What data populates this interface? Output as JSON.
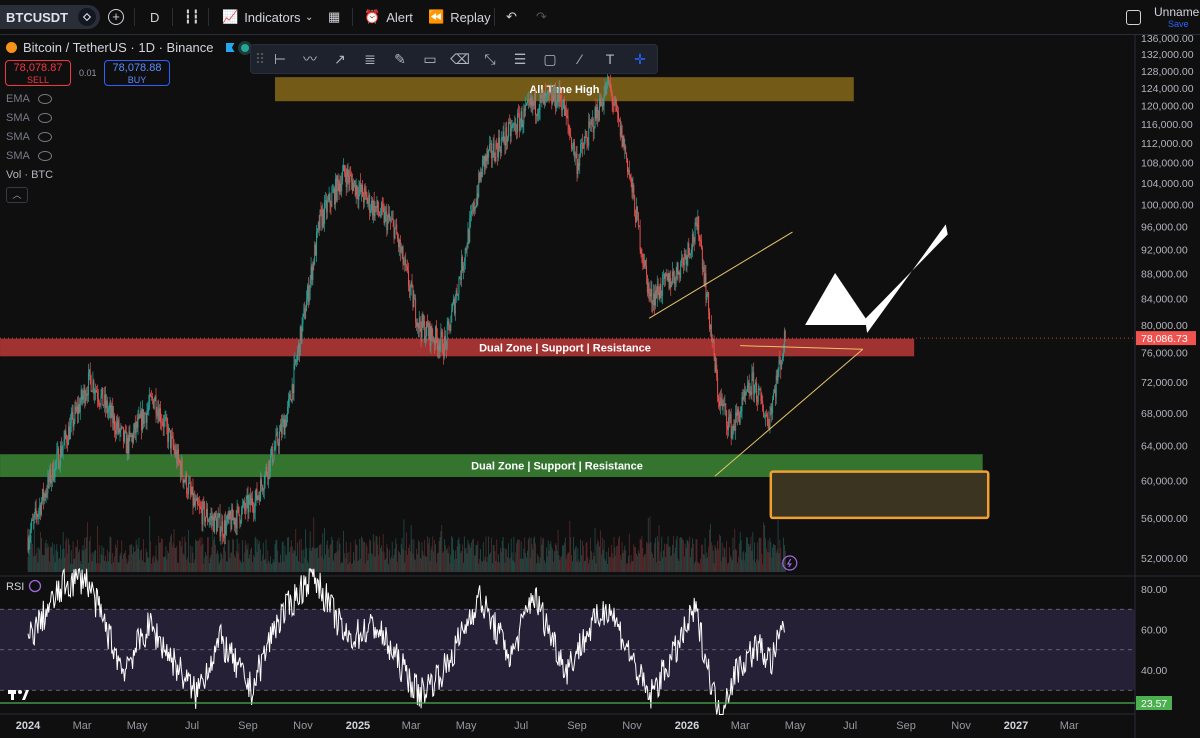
{
  "toolbar": {
    "symbol": "BTCUSDT",
    "interval": "D",
    "indicators_label": "Indicators",
    "alert_label": "Alert",
    "replay_label": "Replay",
    "layout_name": "Unnamed",
    "save_label": "Save"
  },
  "legend": {
    "title": "Bitcoin / TetherUS · 1D · Binance",
    "sell_price": "78,078.87",
    "sell_label": "SELL",
    "spread": "0.01",
    "buy_price": "78,078.88",
    "buy_label": "BUY",
    "indicators": [
      "EMA",
      "SMA",
      "SMA",
      "SMA"
    ],
    "volume_label": "Vol · BTC"
  },
  "icons": {
    "coin": "bitcoin-coin-icon",
    "eye": "eye-off-icon",
    "lightning": "lightning-icon",
    "tv_logo": "tradingview-logo-icon"
  },
  "colors": {
    "bull": "#26a69a",
    "bear": "#ef5350",
    "resistance_zone": "#c23b3b",
    "support_zone": "#3d8b37",
    "ath_zone": "#8b6b1a",
    "target_box": "#f0a030",
    "rsi": "#ffffff",
    "rsi_band": "#2a2440"
  },
  "chart_data": [
    {
      "type": "candlestick",
      "title": "Bitcoin / TetherUS · 1D · Binance",
      "xlabel": "",
      "ylabel": "",
      "y_scale": "log",
      "ylim": [
        49500,
        137000
      ],
      "x_ticks": [
        "2024",
        "Mar",
        "May",
        "Jul",
        "Sep",
        "Nov",
        "2025",
        "Mar",
        "May",
        "Jul",
        "Sep",
        "Nov",
        "2026",
        "Mar",
        "May",
        "Jul",
        "Sep",
        "Nov",
        "2027",
        "Mar"
      ],
      "y_ticks": [
        "136,000.00",
        "132,000.00",
        "128,000.00",
        "124,000.00",
        "120,000.00",
        "116,000.00",
        "112,000.00",
        "108,000.00",
        "104,000.00",
        "100,000.00",
        "96,000.00",
        "92,000.00",
        "88,000.00",
        "84,000.00",
        "80,000.00",
        "76,000.00",
        "72,000.00",
        "68,000.00",
        "64,000.00",
        "60,000.00",
        "56,000.00",
        "52,000.00"
      ],
      "last_price_label": "78,086.73",
      "last_price": 78087,
      "price_path": [
        {
          "x": "2024-01-01",
          "y": 54000
        },
        {
          "x": "2024-02-01",
          "y": 62000
        },
        {
          "x": "2024-03-10",
          "y": 72500
        },
        {
          "x": "2024-04-20",
          "y": 64000
        },
        {
          "x": "2024-05-20",
          "y": 70000
        },
        {
          "x": "2024-07-05",
          "y": 57000
        },
        {
          "x": "2024-08-05",
          "y": 55000
        },
        {
          "x": "2024-09-10",
          "y": 58000
        },
        {
          "x": "2024-10-15",
          "y": 68000
        },
        {
          "x": "2024-11-20",
          "y": 97000
        },
        {
          "x": "2024-12-17",
          "y": 106000
        },
        {
          "x": "2025-01-15",
          "y": 100000
        },
        {
          "x": "2025-02-10",
          "y": 96000
        },
        {
          "x": "2025-03-10",
          "y": 80000
        },
        {
          "x": "2025-04-08",
          "y": 77000
        },
        {
          "x": "2025-05-20",
          "y": 108000
        },
        {
          "x": "2025-07-14",
          "y": 120000
        },
        {
          "x": "2025-08-14",
          "y": 122000
        },
        {
          "x": "2025-09-01",
          "y": 108000
        },
        {
          "x": "2025-10-06",
          "y": 125000
        },
        {
          "x": "2025-10-25",
          "y": 110000
        },
        {
          "x": "2025-11-21",
          "y": 84000
        },
        {
          "x": "2025-12-20",
          "y": 88000
        },
        {
          "x": "2026-01-14",
          "y": 96000
        },
        {
          "x": "2026-02-05",
          "y": 70000
        },
        {
          "x": "2026-02-20",
          "y": 66000
        },
        {
          "x": "2026-03-15",
          "y": 72000
        },
        {
          "x": "2026-04-01",
          "y": 67000
        },
        {
          "x": "2026-04-20",
          "y": 78087
        }
      ],
      "annotations": [
        {
          "type": "zone",
          "label": "All Time High",
          "from": "2024-10-01",
          "to": "2026-07-05",
          "low": 121000,
          "high": 126500,
          "color": "#8b6b1a"
        },
        {
          "type": "zone",
          "label": "Dual Zone | Support | Resistance",
          "from": "2023-12-01",
          "to": "2026-09-10",
          "low": 75500,
          "high": 78000,
          "color": "#c23b3b"
        },
        {
          "type": "zone",
          "label": "Dual Zone | Support | Resistance",
          "from": "2023-12-01",
          "to": "2026-11-25",
          "low": 60400,
          "high": 63000,
          "color": "#3d8b37"
        },
        {
          "type": "box",
          "label": "",
          "from": "2026-03-15",
          "to": "2026-12-10",
          "low": 56000,
          "high": 61000,
          "color": "#f0a030"
        },
        {
          "type": "trendline",
          "from": {
            "x": "2025-11-20",
            "y": 81000
          },
          "to": {
            "x": "2026-04-28",
            "y": 95000
          }
        },
        {
          "type": "trendline",
          "from": {
            "x": "2026-02-01",
            "y": 60500
          },
          "to": {
            "x": "2026-07-15",
            "y": 76500
          }
        },
        {
          "type": "trendline",
          "from": {
            "x": "2026-03-01",
            "y": 77000
          },
          "to": {
            "x": "2026-07-15",
            "y": 76500
          }
        },
        {
          "type": "arrow",
          "from": {
            "x": "2026-10-15",
            "y": 96000
          },
          "to": {
            "x": "2026-05-12",
            "y": 80000
          }
        }
      ]
    },
    {
      "type": "line",
      "title": "RSI",
      "xlabel": "",
      "ylabel": "",
      "ylim": [
        20,
        90
      ],
      "y_ticks": [
        "80.00",
        "60.00",
        "40.00"
      ],
      "bands": {
        "upper": 70,
        "middle": 50,
        "lower": 30
      },
      "current_label": "23.57",
      "current": 23.57,
      "series": [
        {
          "values": [
            {
              "x": "2024-01-01",
              "y": 55
            },
            {
              "x": "2024-02-10",
              "y": 82
            },
            {
              "x": "2024-03-05",
              "y": 86
            },
            {
              "x": "2024-04-15",
              "y": 40
            },
            {
              "x": "2024-05-15",
              "y": 62
            },
            {
              "x": "2024-07-05",
              "y": 28
            },
            {
              "x": "2024-08-01",
              "y": 55
            },
            {
              "x": "2024-09-05",
              "y": 30
            },
            {
              "x": "2024-10-01",
              "y": 62
            },
            {
              "x": "2024-11-12",
              "y": 88
            },
            {
              "x": "2024-12-20",
              "y": 55
            },
            {
              "x": "2025-01-20",
              "y": 62
            },
            {
              "x": "2025-03-10",
              "y": 28
            },
            {
              "x": "2025-04-10",
              "y": 42
            },
            {
              "x": "2025-05-15",
              "y": 76
            },
            {
              "x": "2025-06-20",
              "y": 46
            },
            {
              "x": "2025-07-14",
              "y": 78
            },
            {
              "x": "2025-08-20",
              "y": 40
            },
            {
              "x": "2025-09-15",
              "y": 60
            },
            {
              "x": "2025-10-06",
              "y": 72
            },
            {
              "x": "2025-11-20",
              "y": 26
            },
            {
              "x": "2025-12-20",
              "y": 50
            },
            {
              "x": "2026-01-10",
              "y": 70
            },
            {
              "x": "2026-02-05",
              "y": 18
            },
            {
              "x": "2026-02-25",
              "y": 40
            },
            {
              "x": "2026-03-20",
              "y": 52
            },
            {
              "x": "2026-04-05",
              "y": 44
            },
            {
              "x": "2026-04-20",
              "y": 64
            }
          ]
        }
      ]
    }
  ]
}
